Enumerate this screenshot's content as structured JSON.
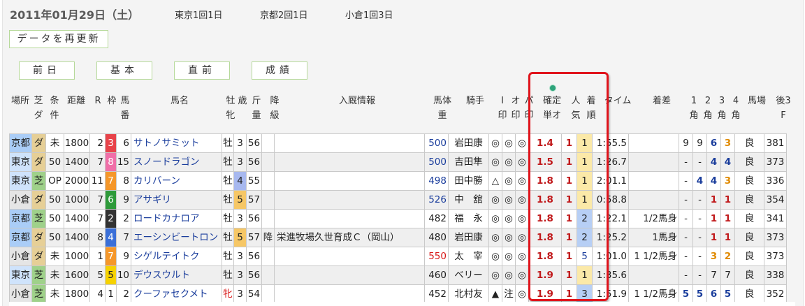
{
  "header": {
    "date": "2011年01月29日（土）",
    "venues": [
      "東京1回1日",
      "京都2回1日",
      "小倉1回3日"
    ],
    "refresh": "データを再更新",
    "nav": [
      "前日",
      "基本",
      "直前",
      "成績"
    ]
  },
  "columns": {
    "venue": "場所",
    "surface": [
      "芝",
      "ダ"
    ],
    "cond": [
      "条",
      "件"
    ],
    "dist": "距離",
    "race": "R",
    "waku": "枠",
    "num": [
      "馬",
      "番"
    ],
    "horse": "馬名",
    "sex": [
      "牡",
      "牝"
    ],
    "age": "歳",
    "weight": [
      "斤",
      "量"
    ],
    "class": [
      "降",
      "級"
    ],
    "stable": "入厩情報",
    "bodyw": [
      "馬体",
      "重"
    ],
    "jockey": "騎手",
    "imark": [
      "I",
      "印"
    ],
    "omark": [
      "オ",
      "印"
    ],
    "pmark": [
      "パ",
      "印"
    ],
    "odds": [
      "確定",
      "単オ"
    ],
    "pop": [
      "人",
      "気"
    ],
    "rank": [
      "着",
      "順"
    ],
    "time": "タイム",
    "margin": "着差",
    "c1": [
      "1",
      "角"
    ],
    "c2": [
      "2",
      "角"
    ],
    "c3": [
      "3",
      "角"
    ],
    "c4": [
      "4",
      "角"
    ],
    "track": "馬場",
    "last": [
      "後3",
      "F"
    ]
  },
  "colors": {
    "waku1": "#ffffff",
    "waku2": "#333333",
    "waku3": "#e8434a",
    "waku4": "#3a6fd8",
    "waku5": "#f6d200",
    "waku6": "#2e9a3a",
    "waku7": "#f5972a",
    "waku8": "#f06fa8",
    "tokyo": "#cfe3fb",
    "kyoto": "#aacdf7",
    "kokura": "#e5e5e5",
    "shiba": "#9fd18a",
    "dirt": "#e6cf96",
    "rank1": "#fbe9a8",
    "rank2": "#b7cff5"
  },
  "rows": [
    {
      "venue": "京都",
      "surface": "ダ",
      "cond": "未",
      "dist": "1800",
      "race": "2",
      "waku": "3",
      "num": "6",
      "horse": "サトノサミット",
      "sex": "牡",
      "age": "3",
      "weight": "56",
      "stable": "",
      "bodyw": "500",
      "jockey": "岩田康",
      "imark": "◎",
      "omark": "◎",
      "pmark": "◎",
      "odds": "1.4",
      "pop": "1",
      "rank": "1",
      "time": "1:55.5",
      "margin": "",
      "c1": "9",
      "c2": "9",
      "c3": "6",
      "c4": "3",
      "track": "良",
      "last": "381"
    },
    {
      "venue": "東京",
      "surface": "ダ",
      "cond": "50",
      "dist": "1400",
      "race": "7",
      "waku": "8",
      "num": "15",
      "horse": "スノードラゴン",
      "sex": "牡",
      "age": "3",
      "weight": "56",
      "stable": "",
      "bodyw": "500",
      "jockey": "吉田隼",
      "imark": "◎",
      "omark": "◎",
      "pmark": "◎",
      "odds": "1.5",
      "pop": "1",
      "rank": "1",
      "time": "1:26.7",
      "margin": "",
      "c1": "-",
      "c2": "-",
      "c3": "4",
      "c4": "4",
      "track": "良",
      "last": "373"
    },
    {
      "venue": "東京",
      "surface": "芝",
      "cond": "OP",
      "dist": "2000",
      "race": "11",
      "waku": "7",
      "num": "8",
      "horse": "カリバーン",
      "sex": "牡",
      "age": "4",
      "weight": "55",
      "stable": "",
      "bodyw": "498",
      "jockey": "田中勝",
      "imark": "△",
      "omark": "◎",
      "pmark": "◎",
      "odds": "1.8",
      "pop": "1",
      "rank": "1",
      "time": "2:01.1",
      "margin": "",
      "c1": "-",
      "c2": "4",
      "c3": "4",
      "c4": "3",
      "track": "良",
      "last": "336"
    },
    {
      "venue": "小倉",
      "surface": "ダ",
      "cond": "50",
      "dist": "1000",
      "race": "7",
      "waku": "6",
      "num": "9",
      "horse": "アサギリ",
      "sex": "牡",
      "age": "5",
      "weight": "57",
      "stable": "",
      "bodyw": "526",
      "jockey": "中　舘",
      "imark": "◎",
      "omark": "◎",
      "pmark": "◎",
      "odds": "1.8",
      "pop": "1",
      "rank": "1",
      "time": "0:58.8",
      "margin": "",
      "c1": "-",
      "c2": "-",
      "c3": "1",
      "c4": "1",
      "track": "良",
      "last": "354"
    },
    {
      "venue": "京都",
      "surface": "芝",
      "cond": "50",
      "dist": "1400",
      "race": "7",
      "waku": "2",
      "num": "2",
      "horse": "ロードカナロア",
      "sex": "牡",
      "age": "3",
      "weight": "56",
      "stable": "",
      "bodyw": "482",
      "jockey": "福　永",
      "imark": "◎",
      "omark": "◎",
      "pmark": "◎",
      "odds": "1.8",
      "pop": "1",
      "rank": "2",
      "time": "1:22.1",
      "margin": "1/2馬身",
      "c1": "-",
      "c2": "-",
      "c3": "1",
      "c4": "1",
      "track": "良",
      "last": "341"
    },
    {
      "venue": "京都",
      "surface": "ダ",
      "cond": "50",
      "dist": "1400",
      "race": "8",
      "waku": "4",
      "num": "7",
      "horse": "エーシンビートロン",
      "sex": "牡",
      "age": "5",
      "weight": "57",
      "class": "降",
      "stable": "栄進牧場久世育成Ｃ（岡山）",
      "bodyw": "480",
      "jockey": "岩田康",
      "imark": "◎",
      "omark": "◎",
      "pmark": "◎",
      "odds": "1.8",
      "pop": "1",
      "rank": "2",
      "time": "1:25.2",
      "margin": "1馬身",
      "c1": "-",
      "c2": "-",
      "c3": "1",
      "c4": "1",
      "track": "良",
      "last": "373"
    },
    {
      "venue": "小倉",
      "surface": "ダ",
      "cond": "未",
      "dist": "1000",
      "race": "1",
      "waku": "7",
      "num": "9",
      "horse": "シゲルテイトク",
      "sex": "牡",
      "age": "3",
      "weight": "56",
      "stable": "",
      "bodyw": "550",
      "jockey": "太　宰",
      "imark": "◎",
      "omark": "◎",
      "pmark": "◎",
      "odds": "1.8",
      "pop": "1",
      "rank": "5",
      "time": "1:01.0",
      "margin": "1 1/2馬身",
      "c1": "-",
      "c2": "-",
      "c3": "3",
      "c4": "2",
      "track": "良",
      "last": "373"
    },
    {
      "venue": "東京",
      "surface": "芝",
      "cond": "未",
      "dist": "1600",
      "race": "5",
      "waku": "5",
      "num": "10",
      "horse": "デウスウルト",
      "sex": "牡",
      "age": "3",
      "weight": "56",
      "stable": "",
      "bodyw": "460",
      "jockey": "ベリー",
      "imark": "◎",
      "omark": "◎",
      "pmark": "◎",
      "odds": "1.9",
      "pop": "1",
      "rank": "1",
      "time": "1:35.6",
      "margin": "",
      "c1": "-",
      "c2": "-",
      "c3": "7",
      "c4": "7",
      "track": "良",
      "last": "338"
    },
    {
      "venue": "小倉",
      "surface": "芝",
      "cond": "未",
      "dist": "1800",
      "race": "4",
      "waku": "1",
      "num": "2",
      "horse": "クーファセクメト",
      "sex": "牝",
      "age": "3",
      "weight": "54",
      "stable": "",
      "bodyw": "452",
      "jockey": "北村友",
      "imark": "▲",
      "omark": "注",
      "pmark": "◎",
      "odds": "1.9",
      "pop": "1",
      "rank": "3",
      "time": "1:51.9",
      "margin": "1 1/2馬身",
      "c1": "5",
      "c2": "5",
      "c3": "6",
      "c4": "5",
      "track": "良",
      "last": "352"
    }
  ]
}
